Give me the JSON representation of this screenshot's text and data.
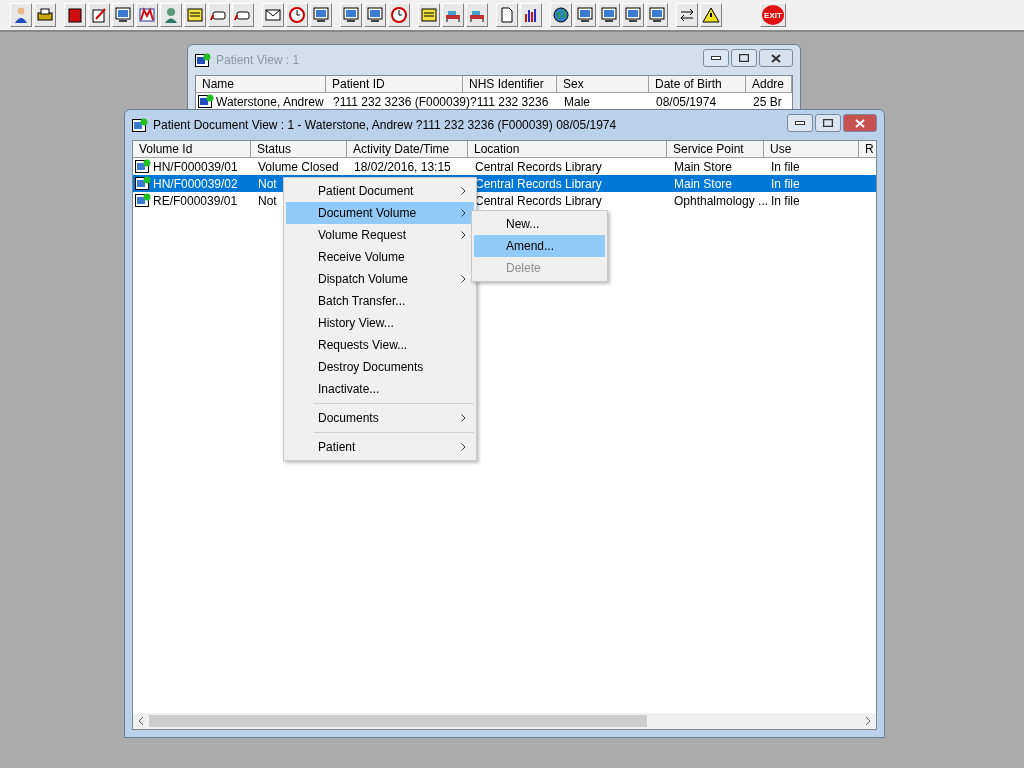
{
  "toolbar": {
    "exit_label": "EXIT"
  },
  "patient_view": {
    "title": "Patient View : 1",
    "active": false,
    "columns": [
      "Name",
      "Patient ID",
      "NHS Identifier",
      "Sex",
      "Date of Birth",
      "Addre"
    ],
    "rows": [
      {
        "cells": [
          "Waterstone, Andrew",
          "?111 232 3236 (F000039)",
          "?111 232 3236",
          "Male",
          "08/05/1974",
          "25 Br"
        ]
      }
    ]
  },
  "document_view": {
    "title": "Patient Document View : 1 - Waterstone, Andrew ?111 232 3236 (F000039) 08/05/1974",
    "active": true,
    "columns": [
      "Volume Id",
      "Status",
      "Activity Date/Time",
      "Location",
      "Service Point",
      "Use",
      "R"
    ],
    "rows": [
      {
        "selected": false,
        "cells": [
          "HN/F000039/01",
          "Volume Closed",
          "18/02/2016, 13:15",
          "Central Records Library",
          "Main Store",
          "In file"
        ]
      },
      {
        "selected": true,
        "cells": [
          "HN/F000039/02",
          "Not",
          "",
          "Central Records Library",
          "Main Store",
          "In file"
        ]
      },
      {
        "selected": false,
        "cells": [
          "RE/F000039/01",
          "Not",
          "",
          "Central Records Library",
          "Ophthalmology ...",
          "In file"
        ]
      }
    ]
  },
  "context_menu": {
    "items": [
      {
        "label": "Patient Document",
        "submenu": true,
        "selected": false,
        "separator_before": false
      },
      {
        "label": "Document Volume",
        "submenu": true,
        "selected": true,
        "separator_before": false
      },
      {
        "label": "Volume Request",
        "submenu": true,
        "selected": false,
        "separator_before": false
      },
      {
        "label": "Receive Volume",
        "submenu": false,
        "selected": false,
        "separator_before": false
      },
      {
        "label": "Dispatch Volume",
        "submenu": true,
        "selected": false,
        "separator_before": false
      },
      {
        "label": "Batch Transfer...",
        "submenu": false,
        "selected": false,
        "separator_before": false
      },
      {
        "label": "History View...",
        "submenu": false,
        "selected": false,
        "separator_before": false
      },
      {
        "label": "Requests View...",
        "submenu": false,
        "selected": false,
        "separator_before": false
      },
      {
        "label": "Destroy Documents",
        "submenu": false,
        "selected": false,
        "separator_before": false
      },
      {
        "label": "Inactivate...",
        "submenu": false,
        "selected": false,
        "separator_before": false
      },
      {
        "label": "Documents",
        "submenu": true,
        "selected": false,
        "separator_before": true
      },
      {
        "label": "Patient",
        "submenu": true,
        "selected": false,
        "separator_before": true
      }
    ]
  },
  "submenu": {
    "items": [
      {
        "label": "New...",
        "selected": false,
        "disabled": false
      },
      {
        "label": "Amend...",
        "selected": true,
        "disabled": false
      },
      {
        "label": "Delete",
        "selected": false,
        "disabled": true
      }
    ]
  }
}
